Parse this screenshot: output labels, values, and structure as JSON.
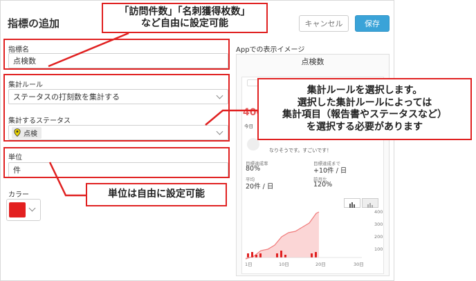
{
  "header": {
    "title": "指標の追加",
    "cancel_label": "キャンセル",
    "save_label": "保存"
  },
  "form": {
    "name_label": "指標名",
    "name_value": "点検数",
    "aggregation_label": "集計ルール",
    "aggregation_value": "ステータスの打刻数を集計する",
    "status_label": "集計するステータス",
    "status_tag": "点検",
    "unit_label": "単位",
    "unit_value": "件",
    "color_label": "カラー",
    "color_value": "#e32020"
  },
  "preview": {
    "label": "Appでの表示イメージ",
    "card_title": "点検数",
    "big_number": "400",
    "today_prefix": "今日",
    "message": "なりそうです。すごいです！",
    "stats": [
      {
        "caption": "目標達成率",
        "value": "80%"
      },
      {
        "caption": "目標達成まで",
        "value": "+10件 / 日"
      },
      {
        "caption": "平均",
        "value": "20件 / 日"
      },
      {
        "caption": "前月比",
        "value": "120%"
      }
    ],
    "chart_y_ticks": [
      "400",
      "300",
      "200",
      "100"
    ],
    "chart_x_ticks": [
      "1日",
      "10日",
      "20日",
      "30日"
    ]
  },
  "callouts": {
    "name_note": [
      "「訪問件数」「名刺獲得枚数」",
      "など自由に設定可能"
    ],
    "rule_note": [
      "集計ルールを選択します。",
      "選択した集計ルールによっては",
      "集計項目（報告書やステータスなど）",
      "を選択する必要があります"
    ],
    "unit_note": "単位は自由に設定可能"
  },
  "colors": {
    "accent": "#3aa3d8",
    "annotation": "#e02020",
    "chart_line": "#f07a7a"
  }
}
